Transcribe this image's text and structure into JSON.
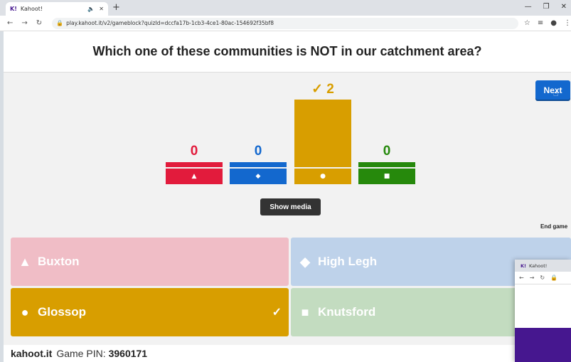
{
  "browser": {
    "tab_title": "Kahoot!",
    "tab_favicon": "K!",
    "url": "play.kahoot.it/v2/gameblock?quizId=dccfa17b-1cb3-4ce1-80ac-154692f35bf8"
  },
  "question": {
    "text": "Which one of these communities is NOT in our catchment area?"
  },
  "controls": {
    "next_label": "Next",
    "show_media_label": "Show media",
    "end_game_label": "End game"
  },
  "chart_data": {
    "type": "bar",
    "categories": [
      "Buxton",
      "High Legh",
      "Glossop",
      "Knutsford"
    ],
    "values": [
      0,
      0,
      2,
      0
    ],
    "count_labels": [
      "0",
      "0",
      "2",
      "0"
    ],
    "colors": [
      "#e21b3c",
      "#1368ce",
      "#d89e00",
      "#26890c"
    ],
    "correct_index": 2,
    "correct_prefix": "✓",
    "ylim": [
      0,
      2
    ]
  },
  "answers": [
    {
      "label": "Buxton",
      "shape": "triangle-icon",
      "color": "#f0bdc6",
      "correct": false
    },
    {
      "label": "High Legh",
      "shape": "diamond-icon",
      "color": "#bed2ea",
      "correct": false
    },
    {
      "label": "Glossop",
      "shape": "circle-icon",
      "color": "#d89e00",
      "correct": true
    },
    {
      "label": "Knutsford",
      "shape": "square-icon",
      "color": "#c3dcc0",
      "correct": false
    }
  ],
  "footer": {
    "brand": "kahoot.it",
    "pin_label": "Game PIN:",
    "pin_value": "3960171"
  },
  "second_window": {
    "tab_title": "Kahoot!",
    "tab_favicon": "K!"
  }
}
